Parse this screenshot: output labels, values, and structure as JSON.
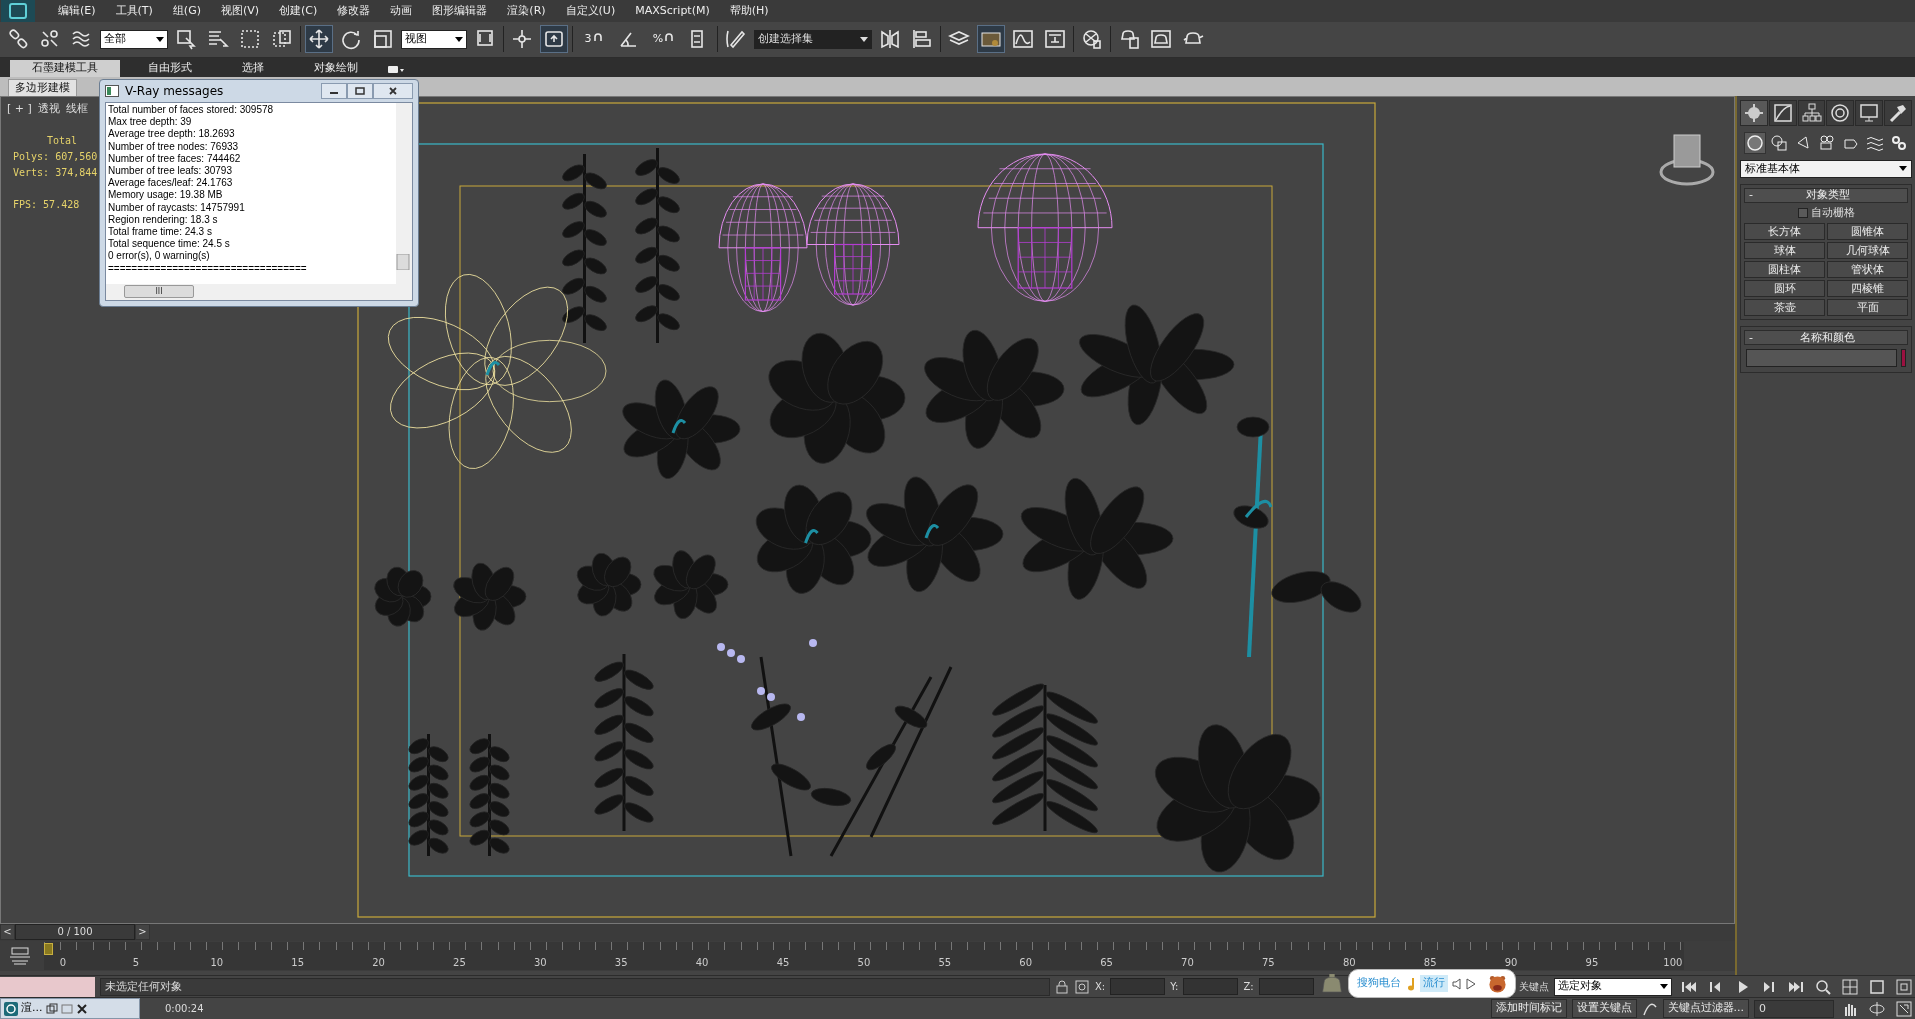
{
  "menu_bar": {
    "items": [
      "编辑(E)",
      "工具(T)",
      "组(G)",
      "视图(V)",
      "创建(C)",
      "修改器",
      "动画",
      "图形编辑器",
      "渲染(R)",
      "自定义(U)",
      "MAXScript(M)",
      "帮助(H)"
    ]
  },
  "toolbar": {
    "selection_filter": "全部",
    "reference_coordinate": "视图",
    "named_selection_set": "创建选择集",
    "snap_toggles": [
      {
        "label": "3"
      },
      {
        "label": "%"
      }
    ]
  },
  "ribbon": {
    "tabs": [
      {
        "label": "石墨建模工具",
        "selected": true
      },
      {
        "label": "自由形式",
        "selected": false
      },
      {
        "label": "选择",
        "selected": false
      },
      {
        "label": "对象绘制",
        "selected": false
      }
    ],
    "panel_tab": "多边形建模"
  },
  "viewport": {
    "labels": [
      "[ + ]",
      "透视",
      "线框"
    ],
    "stats": [
      {
        "label": "Total"
      },
      {
        "label": "Polys:",
        "value": "607,560"
      },
      {
        "label": "Verts:",
        "value": "374,844"
      },
      {
        "label": "FPS:",
        "value": "57.428"
      }
    ]
  },
  "vray_window": {
    "title": "V-Ray messages",
    "lines": [
      "Total number of faces stored: 309578",
      "Max tree depth: 39",
      "Average tree depth: 18.2693",
      "Number of tree nodes: 76933",
      "Number of tree faces: 744462",
      "Number of tree leafs: 30793",
      "Average faces/leaf: 24.1763",
      "Memory usage: 19.38 MB",
      "Number of raycasts: 14757991",
      "Region rendering: 18.3 s",
      "Total frame time: 24.3 s",
      "Total sequence time: 24.5 s",
      "0 error(s), 0 warning(s)",
      "=================================="
    ],
    "scroll_thumb": "III"
  },
  "command_panel": {
    "tabs": [
      {
        "kind": "create",
        "selected": true
      },
      {
        "kind": "modify",
        "selected": false
      },
      {
        "kind": "hierarchy",
        "selected": false
      },
      {
        "kind": "motion",
        "selected": false
      },
      {
        "kind": "display",
        "selected": false
      },
      {
        "kind": "utilities",
        "selected": false
      }
    ],
    "categories": [
      {
        "kind": "geometry",
        "selected": true
      },
      {
        "kind": "shapes",
        "selected": false
      },
      {
        "kind": "lights",
        "selected": false
      },
      {
        "kind": "cameras",
        "selected": false
      },
      {
        "kind": "helpers",
        "selected": false
      },
      {
        "kind": "spacewarps",
        "selected": false
      },
      {
        "kind": "systems",
        "selected": false
      }
    ],
    "dropdown": "标准基本体",
    "object_type": {
      "title": "对象类型",
      "collapse": "-",
      "autogrid": {
        "label": "自动栅格",
        "checked": false
      },
      "buttons": [
        "长方体",
        "圆锥体",
        "球体",
        "几何球体",
        "圆柱体",
        "管状体",
        "圆环",
        "四棱锥",
        "茶壶",
        "平面"
      ]
    },
    "name_color": {
      "title": "名称和颜色",
      "collapse": "-",
      "color": "#9b1040"
    }
  },
  "timeline": {
    "prev": "<",
    "frame": "0 / 100",
    "next": ">",
    "ticks": [
      "0",
      "5",
      "10",
      "15",
      "20",
      "25",
      "30",
      "35",
      "40",
      "45",
      "50",
      "55",
      "60",
      "65",
      "70",
      "75",
      "80",
      "85",
      "90",
      "95",
      "100"
    ]
  },
  "status_bar": {
    "selection": "未选定任何对象",
    "time": "0:00:24",
    "taskbar_item": "渲...",
    "coords": [
      {
        "label": "X:"
      },
      {
        "label": "Y:"
      },
      {
        "label": "Z:"
      }
    ],
    "auto_key": "关键点",
    "key_mode": "选定对象",
    "set_key": "设置关键点",
    "key_filters": "关键点过滤器...",
    "add_time_tag": "添加时间标记",
    "current_frame": "0"
  },
  "radio_popup": {
    "title": "搜狗电台",
    "genre": "流行"
  }
}
